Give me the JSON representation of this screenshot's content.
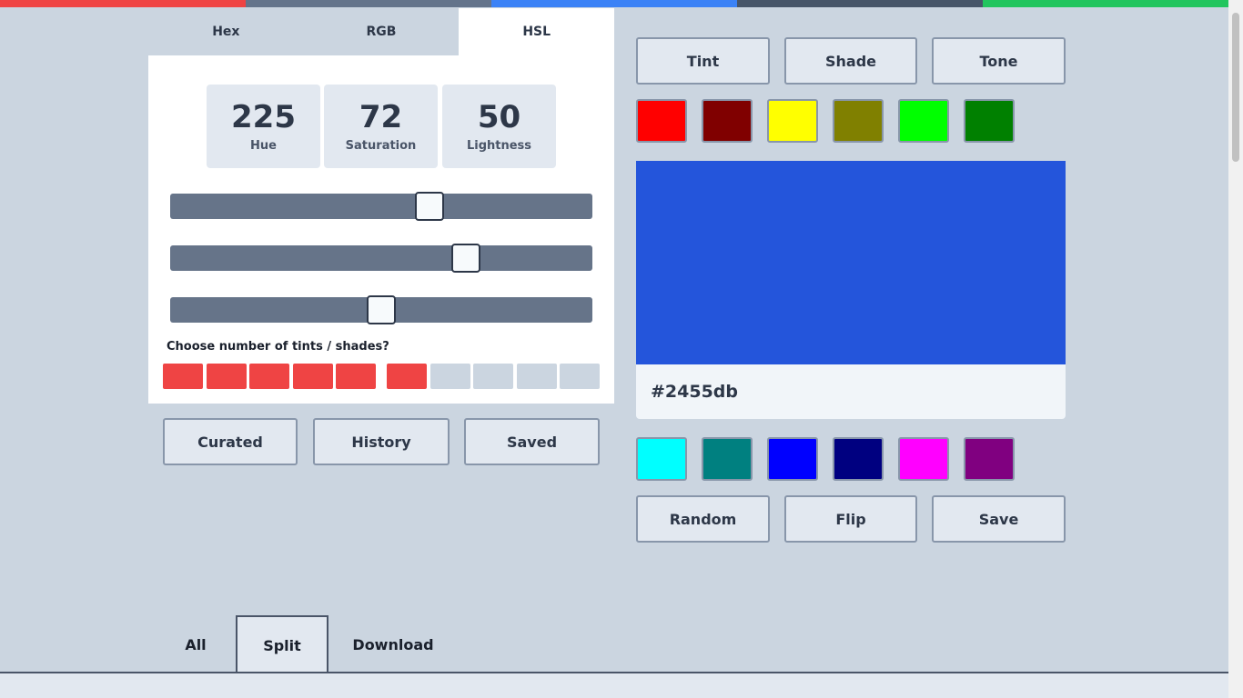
{
  "top_stripe": [
    "#ef4444",
    "#64748b",
    "#3b82f6",
    "#475569",
    "#22c55e"
  ],
  "format_tabs": [
    {
      "label": "Hex",
      "active": false
    },
    {
      "label": "RGB",
      "active": false
    },
    {
      "label": "HSL",
      "active": true
    }
  ],
  "hsl": {
    "hue": {
      "value": "225",
      "label": "Hue",
      "fraction": 0.615
    },
    "saturation": {
      "value": "72",
      "label": "Saturation",
      "fraction": 0.7
    },
    "lightness": {
      "value": "50",
      "label": "Lightness",
      "fraction": 0.5
    }
  },
  "tints": {
    "prompt": "Choose number of tints / shades?",
    "total": 10,
    "selected": 6,
    "on_color": "#ef4444",
    "off_color": "#cbd5e0"
  },
  "list_buttons": {
    "curated": "Curated",
    "history": "History",
    "saved": "Saved"
  },
  "mode_buttons": {
    "tint": "Tint",
    "shade": "Shade",
    "tone": "Tone"
  },
  "swatches_top": [
    "#ff0000",
    "#800000",
    "#ffff00",
    "#808000",
    "#00ff00",
    "#008000"
  ],
  "current_color": {
    "hex": "#2455db",
    "color": "#2455db"
  },
  "swatches_bottom": [
    "#00ffff",
    "#008080",
    "#0000ff",
    "#000080",
    "#ff00ff",
    "#800080"
  ],
  "action_buttons": {
    "random": "Random",
    "flip": "Flip",
    "save": "Save"
  },
  "bottom_tabs": [
    {
      "label": "All",
      "active": false
    },
    {
      "label": "Split",
      "active": true
    },
    {
      "label": "Download",
      "active": false
    }
  ]
}
